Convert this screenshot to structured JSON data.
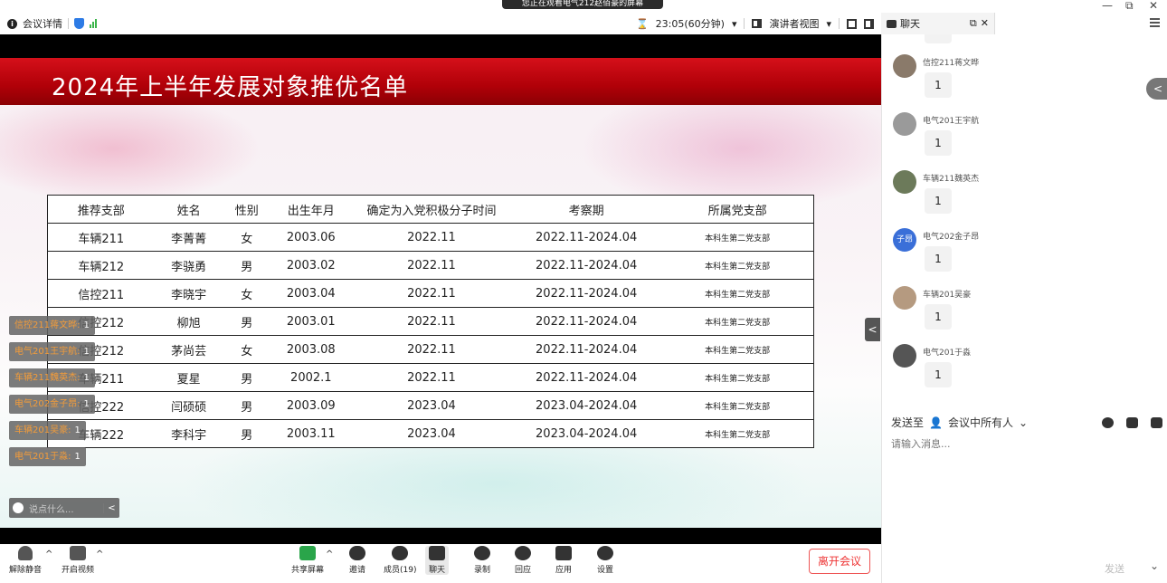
{
  "window": {
    "sharing_banner": "您正在观看电气212赵佰豪的屏幕",
    "minimize": "—",
    "restore": "⧉",
    "close": "✕"
  },
  "topbar": {
    "meeting_details": "会议详情",
    "timer": "23:05(60分钟)",
    "speaker_view": "演讲者视图"
  },
  "chat_header": {
    "tab_label": "聊天"
  },
  "slide": {
    "title": "2024年上半年发展对象推优名单",
    "table": {
      "headers": [
        "推荐支部",
        "姓名",
        "性别",
        "出生年月",
        "确定为入党积极分子时间",
        "考察期",
        "所属党支部"
      ],
      "rows": [
        [
          "车辆211",
          "李菁菁",
          "女",
          "2003.06",
          "2022.11",
          "2022.11-2024.04",
          "本科生第二党支部"
        ],
        [
          "车辆212",
          "李骁勇",
          "男",
          "2003.02",
          "2022.11",
          "2022.11-2024.04",
          "本科生第二党支部"
        ],
        [
          "信控211",
          "李晓宇",
          "女",
          "2003.04",
          "2022.11",
          "2022.11-2024.04",
          "本科生第二党支部"
        ],
        [
          "信控212",
          "柳旭",
          "男",
          "2003.01",
          "2022.11",
          "2022.11-2024.04",
          "本科生第二党支部"
        ],
        [
          "信控212",
          "茅尚芸",
          "女",
          "2003.08",
          "2022.11",
          "2022.11-2024.04",
          "本科生第二党支部"
        ],
        [
          "车辆211",
          "夏星",
          "男",
          "2002.1",
          "2022.11",
          "2022.11-2024.04",
          "本科生第二党支部"
        ],
        [
          "信控222",
          "闫硕硕",
          "男",
          "2003.09",
          "2023.04",
          "2023.04-2024.04",
          "本科生第二党支部"
        ],
        [
          "车辆222",
          "李科宇",
          "男",
          "2003.11",
          "2023.04",
          "2023.04-2024.04",
          "本科生第二党支部"
        ]
      ]
    },
    "danmaku": [
      {
        "who": "信控211蒋文晔:",
        "text": "1"
      },
      {
        "who": "电气201王宇航:",
        "text": "1"
      },
      {
        "who": "车辆211魏英杰:",
        "text": "1"
      },
      {
        "who": "电气202金子昂:",
        "text": "1"
      },
      {
        "who": "车辆201吴豪:",
        "text": "1"
      },
      {
        "who": "电气201于淼:",
        "text": "1"
      }
    ],
    "say_placeholder": "说点什么...",
    "say_caret": "<",
    "collapse": "<"
  },
  "bottombar": {
    "unmute": "解除静音",
    "start_video": "开启视频",
    "share_screen": "共享屏幕",
    "invite": "邀请",
    "members": "成员(19)",
    "chat": "聊天",
    "record": "录制",
    "react": "回应",
    "apps": "应用",
    "settings": "设置",
    "leave": "离开会议"
  },
  "chat": {
    "messages": [
      {
        "name": "信控211蒋文晔",
        "text": "1"
      },
      {
        "name": "电气201王宇航",
        "text": "1"
      },
      {
        "name": "车辆211魏英杰",
        "text": "1"
      },
      {
        "name": "电气202金子昂",
        "text": "1",
        "avatar_text": "子昂"
      },
      {
        "name": "车辆201吴豪",
        "text": "1"
      },
      {
        "name": "电气201于淼",
        "text": "1"
      }
    ],
    "send_to_label": "发送至",
    "send_to_target": "会议中所有人",
    "input_placeholder": "请输入消息...",
    "send_button": "发送",
    "scroll_arrow": "<"
  },
  "colors": {
    "title_band": "#c00010",
    "leave_red": "#e33",
    "danmaku_name": "#f39c3a",
    "signal_green": "#3bb54a",
    "shield_blue": "#2d7be5"
  }
}
